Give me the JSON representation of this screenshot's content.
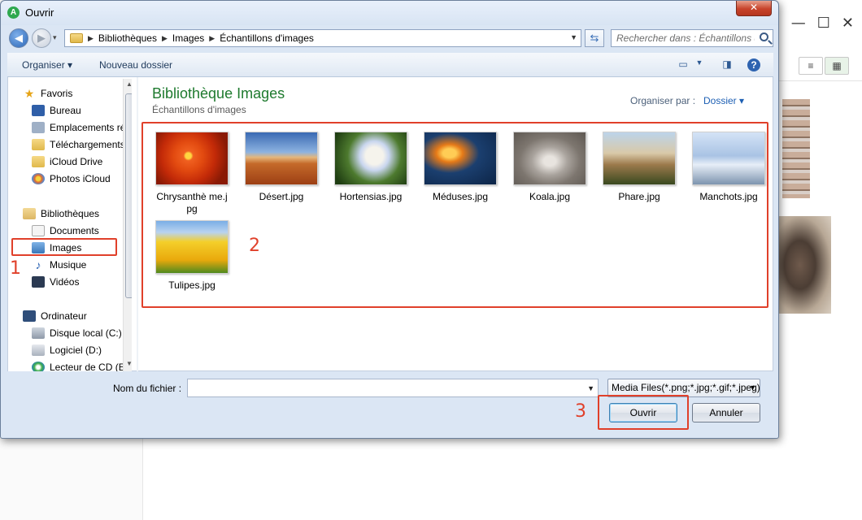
{
  "dialog": {
    "title": "Ouvrir",
    "close_glyph": "✕"
  },
  "address": {
    "crumbs": [
      "Bibliothèques",
      "Images",
      "Échantillons d'images"
    ],
    "search_placeholder": "Rechercher dans : Échantillons d'images"
  },
  "toolbar": {
    "organiser": "Organiser ▾",
    "nouveau_dossier": "Nouveau dossier"
  },
  "nav": {
    "favoris": "Favoris",
    "favoris_items": [
      "Bureau",
      "Emplacements récents",
      "Téléchargements",
      "iCloud Drive",
      "Photos iCloud"
    ],
    "bibliotheques": "Bibliothèques",
    "bib_items": [
      "Documents",
      "Images",
      "Musique",
      "Vidéos"
    ],
    "ordinateur": "Ordinateur",
    "ord_items": [
      "Disque local (C:)",
      "Logiciel (D:)",
      "Lecteur de CD (E:)"
    ]
  },
  "content": {
    "library_title": "Bibliothèque Images",
    "library_subtitle": "Échantillons d'images",
    "arrange_label": "Organiser par :",
    "arrange_value": "Dossier ▾",
    "files": [
      {
        "name": "Chrysanthème.jpg",
        "label": "Chrysanthè me.jpg",
        "icon": "chrysanthemum-thumbnail"
      },
      {
        "name": "Désert.jpg",
        "label": "Désert.jpg",
        "icon": "desert-thumbnail"
      },
      {
        "name": "Hortensias.jpg",
        "label": "Hortensias.jpg",
        "icon": "hydrangea-thumbnail"
      },
      {
        "name": "Méduses.jpg",
        "label": "Méduses.jpg",
        "icon": "jellyfish-thumbnail"
      },
      {
        "name": "Koala.jpg",
        "label": "Koala.jpg",
        "icon": "koala-thumbnail"
      },
      {
        "name": "Phare.jpg",
        "label": "Phare.jpg",
        "icon": "lighthouse-thumbnail"
      },
      {
        "name": "Manchots.jpg",
        "label": "Manchots.jpg",
        "icon": "penguins-thumbnail"
      },
      {
        "name": "Tulipes.jpg",
        "label": "Tulipes.jpg",
        "icon": "tulips-thumbnail"
      }
    ]
  },
  "bottom": {
    "filename_label": "Nom du fichier :",
    "filename_value": "",
    "filter_value": "Media Files(*.png;*.jpg;*.gif;*.jpeg)",
    "open_button": "Ouvrir",
    "cancel_button": "Annuler"
  },
  "annotations": {
    "step1": "1",
    "step2": "2",
    "step3": "3",
    "color": "#e0402a"
  }
}
